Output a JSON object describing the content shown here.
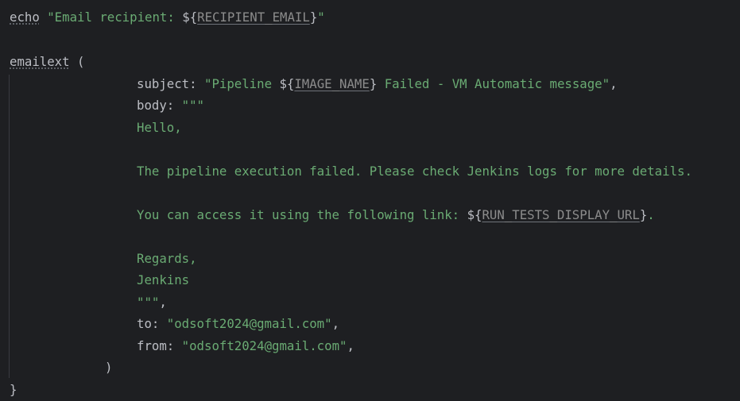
{
  "code": {
    "echo_cmd": "echo",
    "echo_str_open": "\"Email recipient: ",
    "echo_interp_open": "${",
    "echo_var": "RECIPIENT_EMAIL",
    "echo_interp_close": "}",
    "echo_str_close": "\"",
    "emailext_fn": "emailext",
    "paren_open": " (",
    "subject_key": "subject",
    "colon_space": ": ",
    "subject_str_open": "\"Pipeline ",
    "interp_open": "${",
    "subject_var": "IMAGE_NAME",
    "interp_close": "}",
    "subject_str_close": " Failed - VM Automatic message\"",
    "comma": ",",
    "body_key": "body",
    "triple_quote": "\"\"\"",
    "hello": "Hello,",
    "pipeline_failed": "The pipeline execution failed. Please check Jenkins logs for more details.",
    "access_prefix": "You can access it using the following link: ",
    "access_var": "RUN_TESTS_DISPLAY_URL",
    "access_suffix": ".",
    "regards": "Regards,",
    "jenkins": "Jenkins",
    "to_key": "to",
    "to_value": "\"odsoft2024@gmail.com\"",
    "from_key": "from",
    "from_value": "\"odsoft2024@gmail.com\"",
    "paren_close": ")",
    "brace_close": "}"
  }
}
